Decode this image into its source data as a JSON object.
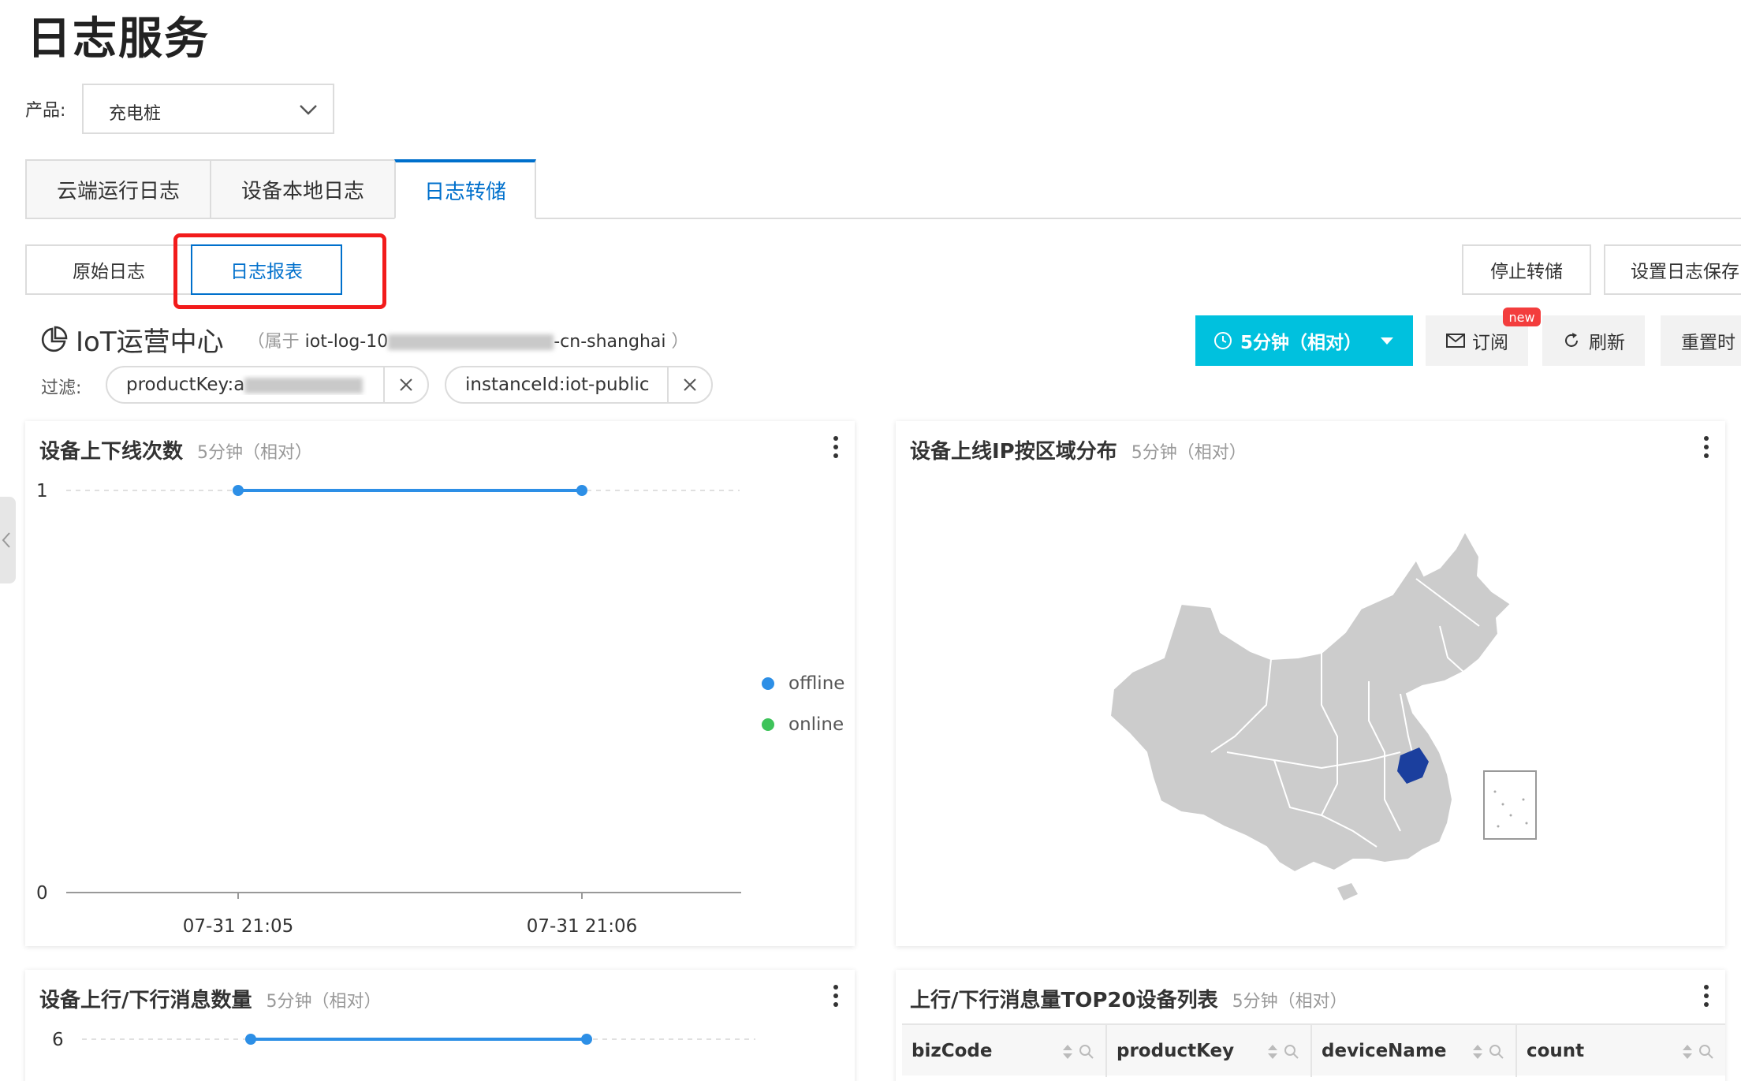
{
  "page": {
    "title": "日志服务"
  },
  "product": {
    "label": "产品:",
    "value": "充电桩"
  },
  "tabs": [
    {
      "label": "云端运行日志"
    },
    {
      "label": "设备本地日志"
    },
    {
      "label": "日志转储"
    }
  ],
  "subtabs": [
    {
      "label": "原始日志"
    },
    {
      "label": "日志报表"
    }
  ],
  "actions": {
    "stop_dump": "停止转储",
    "set_retention": "设置日志保存"
  },
  "dashboard": {
    "name": "IoT运营中心",
    "owner_prefix": "（属于",
    "owner_id": "iot-log-10",
    "owner_suffix": "-cn-shanghai",
    "owner_close": "）"
  },
  "toolbar": {
    "time_range": "5分钟（相对）",
    "subscribe": "订阅",
    "new_badge": "new",
    "refresh": "刷新",
    "reset_time": "重置时"
  },
  "filter": {
    "label": "过滤:",
    "chips": [
      {
        "text": "productKey:a"
      },
      {
        "text": "instanceId:iot-public"
      }
    ]
  },
  "panels": {
    "online_count": {
      "title": "设备上下线次数",
      "subtitle": "5分钟（相对）"
    },
    "ip_region": {
      "title": "设备上线IP按区域分布",
      "subtitle": "5分钟（相对）"
    },
    "msg_count": {
      "title": "设备上行/下行消息数量",
      "subtitle": "5分钟（相对）"
    },
    "top20": {
      "title": "上行/下行消息量TOP20设备列表",
      "subtitle": "5分钟（相对）",
      "columns": [
        "bizCode",
        "productKey",
        "deviceName",
        "count"
      ]
    }
  },
  "chart_data": [
    {
      "type": "line",
      "title": "设备上下线次数",
      "x": [
        "07-31 21:05",
        "07-31 21:06"
      ],
      "ylim": [
        0,
        1
      ],
      "yticks": [
        "1",
        "0"
      ],
      "series": [
        {
          "name": "offline",
          "values": [
            1,
            1
          ],
          "color": "#2d8fe6"
        },
        {
          "name": "online",
          "values": [],
          "color": "#3ec35a"
        }
      ],
      "legend": "right"
    },
    {
      "type": "line",
      "title": "设备上行/下行消息数量",
      "yticks": [
        "6"
      ],
      "series": [
        {
          "values": [
            6,
            6
          ],
          "color": "#2d8fe6"
        }
      ]
    }
  ],
  "colors": {
    "accent": "#0070cc",
    "primary_button": "#00c1de",
    "highlight": "#f21b1b",
    "map_fill": "#cccccc",
    "map_highlight": "#1b3f9e"
  }
}
